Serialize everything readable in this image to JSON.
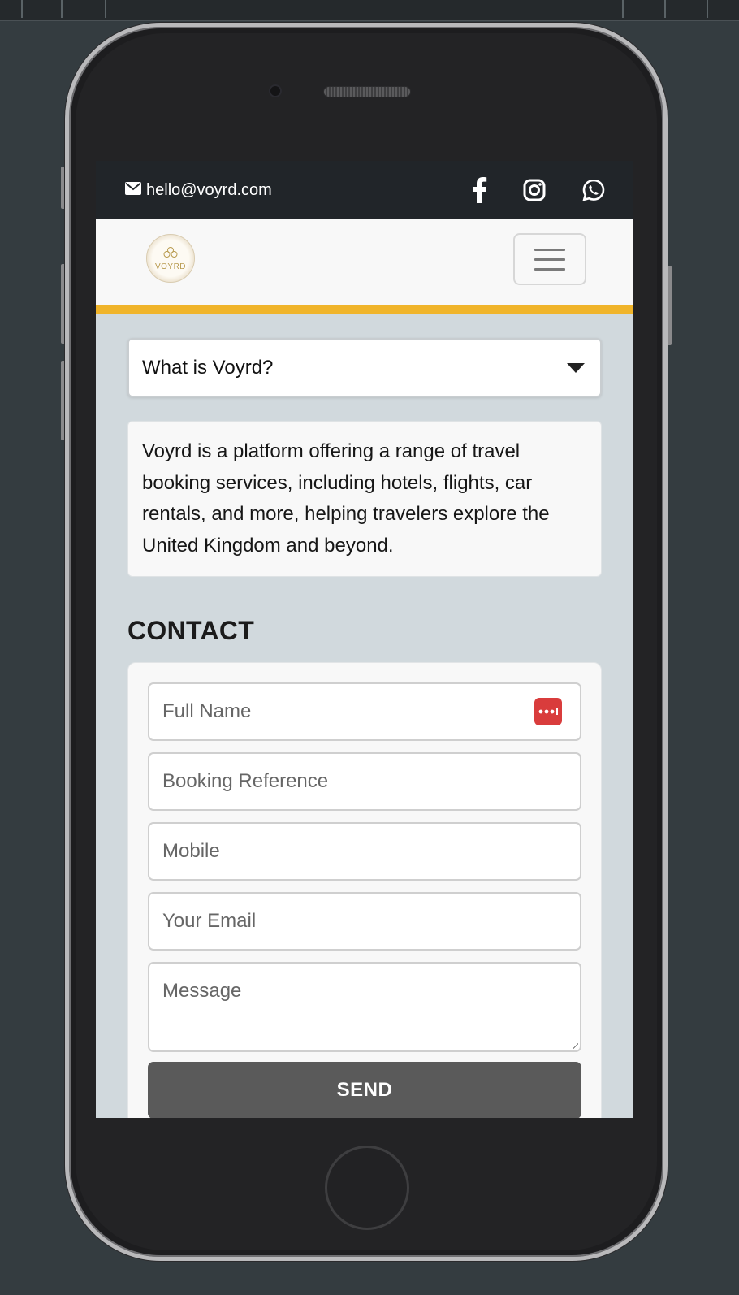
{
  "topbar": {
    "email": "hello@voyrd.com",
    "email_icon": "envelope-icon",
    "social_icons": [
      "facebook-icon",
      "instagram-icon",
      "whatsapp-icon"
    ]
  },
  "navbar": {
    "logo_text": "VOYRD",
    "menu_icon": "hamburger-menu-icon"
  },
  "faq": {
    "question": "What is Voyrd?",
    "answer": "Voyrd is a platform offering a range of travel booking services, including hotels, flights, car rentals, and more, helping travelers explore the United Kingdom and beyond."
  },
  "contact": {
    "title": "CONTACT",
    "fields": {
      "full_name": "Full Name",
      "booking_reference": "Booking Reference",
      "mobile": "Mobile",
      "email": "Your Email",
      "message": "Message"
    },
    "send_label": "SEND"
  },
  "colors": {
    "topbar_bg": "#212529",
    "accent": "#f0b42a",
    "page_bg": "#d1d9dd",
    "send_button": "#5a5a5a",
    "password_badge": "#d93c3c"
  }
}
